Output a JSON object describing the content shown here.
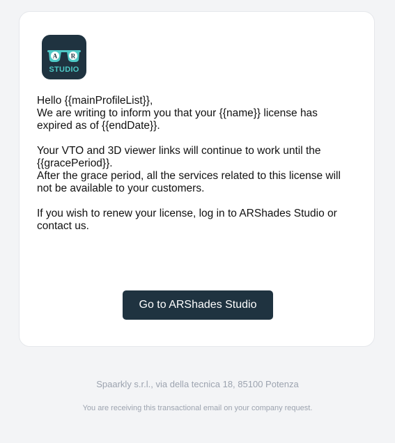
{
  "logo": {
    "letters": [
      "A",
      "R"
    ],
    "label": "STUDIO",
    "colors": {
      "background": "#1f3340",
      "accent": "#4ec9c6"
    }
  },
  "email": {
    "greeting": "Hello {{mainProfileList}},",
    "line_inform_1": "We are writing to inform you that your {{name}} license has",
    "line_inform_2": "expired as of {{endDate}}.",
    "line_links_1": "Your VTO and 3D viewer links will continue to work until the",
    "line_links_2": "{{gracePeriod}}.",
    "line_after_1": "After the grace period, all the services related to this license will",
    "line_after_2": "not be available to your customers.",
    "line_renew_1": "If you wish to renew your license, log in to ARShades Studio or",
    "line_renew_2": "contact us."
  },
  "cta": {
    "label": "Go to ARShades Studio",
    "color": "#1f3340"
  },
  "footer": {
    "address": "Spaarkly s.r.l., via della tecnica 18, 85100 Potenza",
    "note": "You are receiving this transactional email on your company request."
  }
}
